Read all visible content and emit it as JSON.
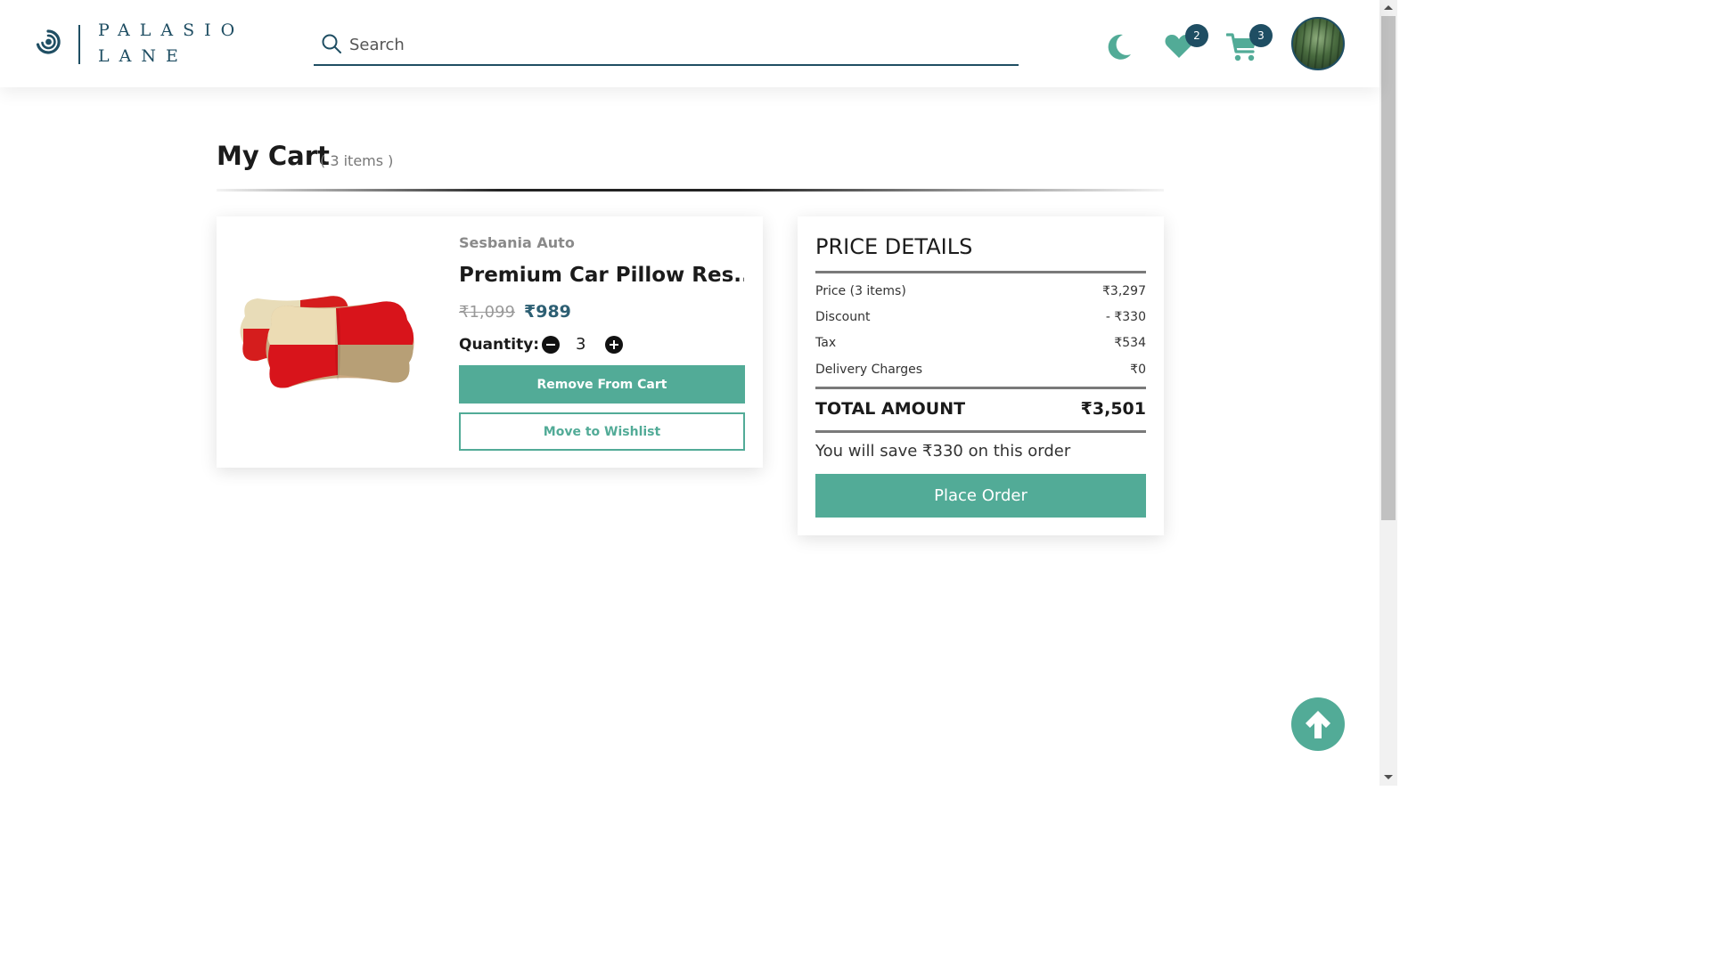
{
  "brand": {
    "line1": "PALASIO",
    "line2": "LANE",
    "logo_icon": "swirl-logo-icon",
    "color": "#1f4e63"
  },
  "search": {
    "placeholder": "Search",
    "value": "",
    "icon": "search-icon"
  },
  "header": {
    "theme_icon": "moon-icon",
    "wishlist_icon": "heart-icon",
    "wishlist_count": "2",
    "cart_icon": "cart-icon",
    "cart_count": "3",
    "avatar": "avatar"
  },
  "page": {
    "title": "My Cart",
    "item_count": "( 3 items )"
  },
  "cart_items": [
    {
      "brand": "Sesbania Auto",
      "name": "Premium Car Pillow Res...",
      "original_price": "₹1,099",
      "price": "₹989",
      "quantity_label": "Quantity:",
      "quantity": "3",
      "remove_label": "Remove From Cart",
      "wishlist_label": "Move to Wishlist",
      "image": "car-neck-pillow-image"
    }
  ],
  "price_details": {
    "heading": "PRICE DETAILS",
    "rows": [
      {
        "label": "Price (3 items)",
        "value": "₹3,297"
      },
      {
        "label": "Discount",
        "value": "- ₹330"
      },
      {
        "label": "Tax",
        "value": "₹534"
      },
      {
        "label": "Delivery Charges",
        "value": "₹0"
      }
    ],
    "total_label": "TOTAL AMOUNT",
    "total_value": "₹3,501",
    "savings_text": "You will save ₹330 on this order",
    "place_order_label": "Place Order"
  },
  "back_to_top_icon": "arrow-up-icon",
  "colors": {
    "accent": "#52ab97",
    "dark_teal": "#1f4e63",
    "price_teal": "#2d5f73"
  }
}
